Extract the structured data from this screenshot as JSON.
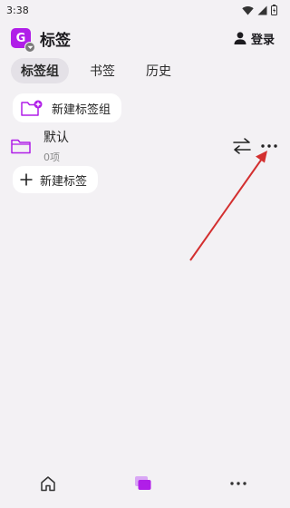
{
  "status_bar": {
    "time": "3:38"
  },
  "app": {
    "icon_letter": "G",
    "title": "标签",
    "login_label": "登录"
  },
  "tabs": [
    {
      "label": "标签组",
      "active": true
    },
    {
      "label": "书签",
      "active": false
    },
    {
      "label": "历史",
      "active": false
    }
  ],
  "new_group_label": "新建标签组",
  "group": {
    "name": "默认",
    "count": "0项"
  },
  "new_tag_label": "新建标签",
  "colors": {
    "accent": "#b01ee8",
    "background": "#f3f1f4",
    "annotation_arrow": "#d32f2f"
  },
  "bottom_nav": [
    {
      "icon": "home-icon"
    },
    {
      "icon": "tabs-icon",
      "active": true
    },
    {
      "icon": "more-icon"
    }
  ]
}
